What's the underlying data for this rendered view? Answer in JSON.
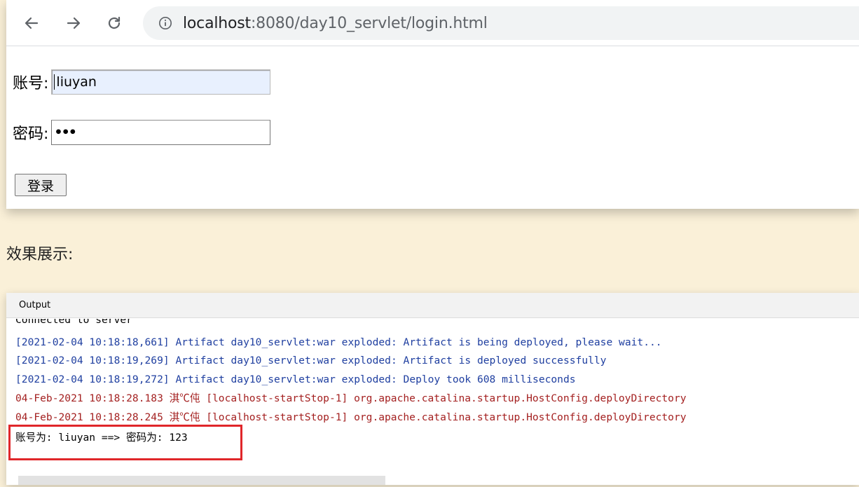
{
  "browser": {
    "nav": {
      "back_icon": "arrow-left-icon",
      "forward_icon": "arrow-right-icon",
      "reload_icon": "reload-icon"
    },
    "address_bar": {
      "info_icon": "info-icon",
      "host": "localhost",
      "path": ":8080/day10_servlet/login.html"
    },
    "form": {
      "account_label": "账号:",
      "account_value": "liuyan",
      "password_label": "密码:",
      "password_value": "•••",
      "submit_label": "登录"
    }
  },
  "caption": "效果展示:",
  "console": {
    "title": "Output",
    "lines": [
      {
        "text": "Connected to server",
        "color": "black"
      },
      {
        "text": "[2021-02-04 10:18:18,661] Artifact day10_servlet:war exploded: Artifact is being deployed, please wait...",
        "color": "blue"
      },
      {
        "text": "[2021-02-04 10:18:19,269] Artifact day10_servlet:war exploded: Artifact is deployed successfully",
        "color": "blue"
      },
      {
        "text": "[2021-02-04 10:18:19,272] Artifact day10_servlet:war exploded: Deploy took 608 milliseconds",
        "color": "blue"
      },
      {
        "text": "04-Feb-2021 10:18:28.183 淇℃伅 [localhost-startStop-1] org.apache.catalina.startup.HostConfig.deployDirectory",
        "color": "red"
      },
      {
        "text": "04-Feb-2021 10:18:28.245 淇℃伅 [localhost-startStop-1] org.apache.catalina.startup.HostConfig.deployDirectory",
        "color": "red"
      },
      {
        "text": "账号为: liuyan ==> 密码为: 123",
        "color": "black"
      }
    ]
  },
  "colors": {
    "page_background": "#faf0d8",
    "highlight": "#e0262a",
    "log_blue": "#1f3fa0",
    "log_red": "#a42121"
  }
}
